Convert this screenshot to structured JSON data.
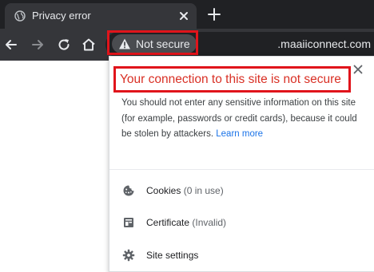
{
  "tab": {
    "title": "Privacy error"
  },
  "toolbar": {
    "security_chip_label": "Not secure",
    "url": ".maaiiconnect.com"
  },
  "popup": {
    "title": "Your connection to this site is not secure",
    "body": "You should not enter any sensitive information on this site (for example, passwords or credit cards), because it could be stolen by attackers.",
    "learn_more": "Learn more",
    "items": [
      {
        "label": "Cookies",
        "sub": "(0 in use)",
        "icon": "cookie-icon"
      },
      {
        "label": "Certificate",
        "sub": "(Invalid)",
        "icon": "certificate-icon"
      },
      {
        "label": "Site settings",
        "sub": "",
        "icon": "gear-icon"
      }
    ]
  },
  "colors": {
    "highlight": "#e0141b",
    "danger_text": "#d93025",
    "link": "#1a73e8",
    "chrome_dark": "#202124",
    "toolbar": "#35363a"
  }
}
